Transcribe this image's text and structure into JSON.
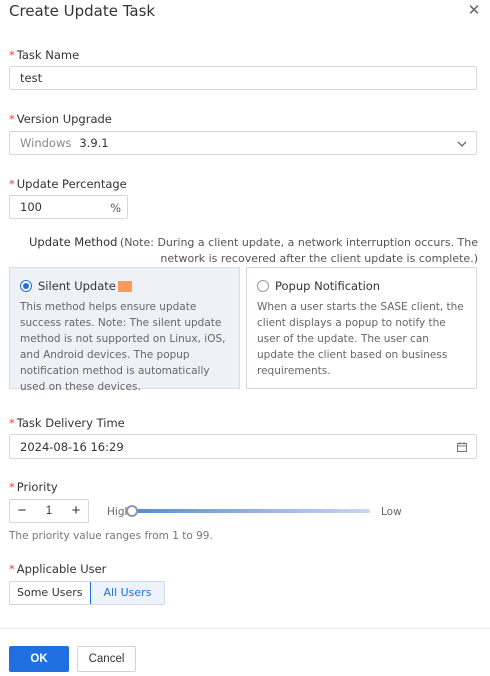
{
  "dialog": {
    "title": "Create Update Task",
    "close_icon": "close-icon"
  },
  "task_name": {
    "label": "Task Name",
    "value": "test"
  },
  "version_upgrade": {
    "label": "Version Upgrade",
    "platform": "Windows",
    "version": "3.9.1",
    "icon": "chevron-down-icon"
  },
  "update_percentage": {
    "label": "Update Percentage",
    "value": "100",
    "suffix": "%"
  },
  "update_method": {
    "label": "Update Method",
    "note": "(Note: During a client update, a network interruption occurs. The network is recovered after the client update is complete.)",
    "options": [
      {
        "title": "Silent Update",
        "selected": true,
        "description": "This method helps ensure update success rates. Note: The silent update method is not supported on Linux, iOS, and Android devices. The popup notification method is automatically used on these devices."
      },
      {
        "title": "Popup Notification",
        "selected": false,
        "description": "When a user starts the SASE client, the client displays a popup to notify the user of the update. The user can update the client based on business requirements."
      }
    ]
  },
  "task_delivery_time": {
    "label": "Task Delivery Time",
    "value": "2024-08-16 16:29",
    "icon": "calendar-icon"
  },
  "priority": {
    "label": "Priority",
    "value": "1",
    "minus": "−",
    "plus": "+",
    "slider_high": "High",
    "slider_low": "Low",
    "slider_level": 0.0,
    "hint": "The priority value ranges from 1 to 99."
  },
  "applicable_user": {
    "label": "Applicable User",
    "options": [
      "Some Users",
      "All Users"
    ],
    "selected": "All Users"
  },
  "footer": {
    "ok_label": "OK",
    "cancel_label": "Cancel"
  },
  "colors": {
    "primary": "#1f6fe0",
    "required": "#e8412f"
  }
}
